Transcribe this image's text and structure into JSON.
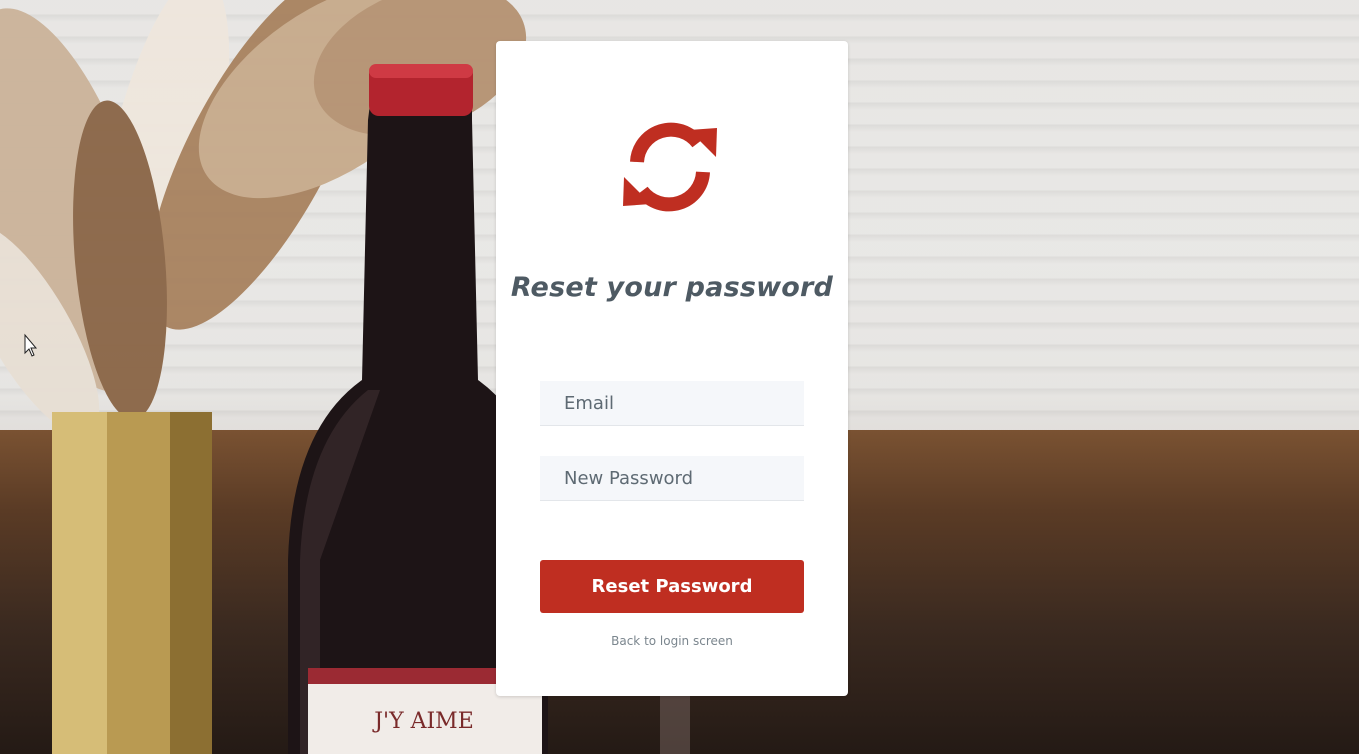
{
  "colors": {
    "accent": "#bf2e21",
    "title_text": "#4e5a63",
    "field_bg": "#f5f7fa",
    "link_text": "#7b868e"
  },
  "icon": "refresh-icon",
  "card": {
    "title": "Reset your password",
    "email_placeholder": "Email",
    "password_placeholder": "New Password",
    "submit_label": "Reset Password",
    "back_link": "Back to login screen"
  },
  "background": {
    "label_text": "J'Y AIME"
  }
}
